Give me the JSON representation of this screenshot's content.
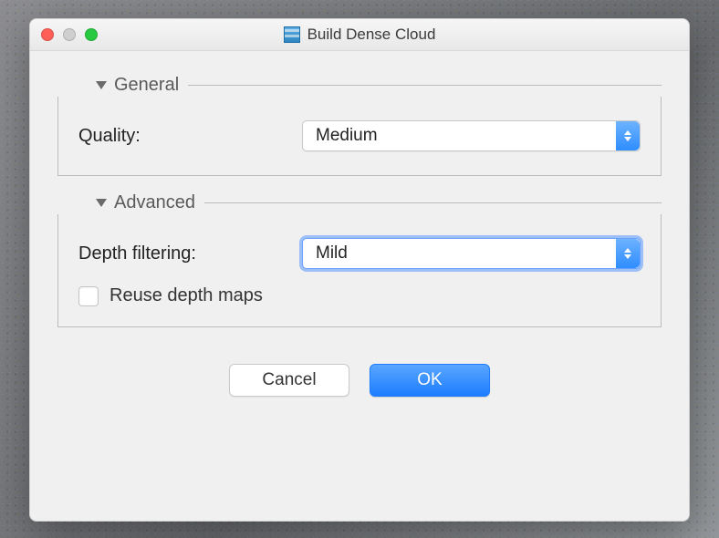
{
  "window": {
    "title": "Build Dense Cloud"
  },
  "sections": {
    "general": {
      "title": "General",
      "quality_label": "Quality:",
      "quality_value": "Medium"
    },
    "advanced": {
      "title": "Advanced",
      "depth_filtering_label": "Depth filtering:",
      "depth_filtering_value": "Mild",
      "reuse_depth_maps_label": "Reuse depth maps",
      "reuse_depth_maps_checked": false
    }
  },
  "buttons": {
    "cancel": "Cancel",
    "ok": "OK"
  }
}
